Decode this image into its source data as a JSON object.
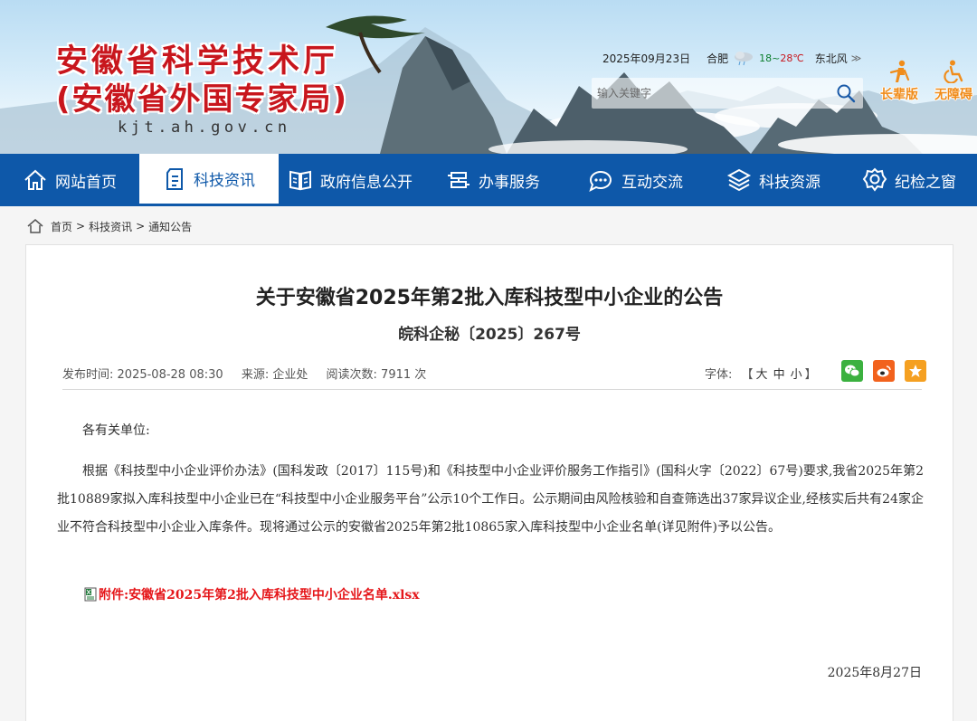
{
  "header": {
    "title": "安徽省科学技术厅",
    "subtitle": "(安徽省外国专家局)",
    "domain": "kjt.ah.gov.cn",
    "date": "2025年09月23日",
    "city": "合肥",
    "weather_icon": "rain-cloud-icon",
    "temp_low": "18",
    "temp_sep": "~",
    "temp_high": "28℃",
    "wind": "东北风",
    "more": "≫",
    "search_placeholder": "输入关键字",
    "tools": [
      {
        "label": "长辈版",
        "icon": "elder-icon"
      },
      {
        "label": "无障碍",
        "icon": "accessibility-icon"
      }
    ]
  },
  "nav": {
    "items": [
      {
        "label": "网站首页",
        "icon": "home-icon"
      },
      {
        "label": "科技资讯",
        "icon": "document-icon"
      },
      {
        "label": "政府信息公开",
        "icon": "book-icon"
      },
      {
        "label": "办事服务",
        "icon": "service-icon"
      },
      {
        "label": "互动交流",
        "icon": "chat-icon"
      },
      {
        "label": "科技资源",
        "icon": "cube-icon"
      },
      {
        "label": "纪检之窗",
        "icon": "badge-icon"
      }
    ],
    "active": "科技资讯"
  },
  "breadcrumb": {
    "items": [
      "首页",
      "科技资讯",
      "通知公告"
    ],
    "sep": ">"
  },
  "article": {
    "title": "关于安徽省2025年第2批入库科技型中小企业的公告",
    "doc_no": "皖科企秘〔2025〕267号",
    "publish_label": "发布时间:",
    "publish_time": "2025-08-28 08:30",
    "source_label": "来源:",
    "source": "企业处",
    "views_label": "阅读次数:",
    "views": "7911",
    "views_unit": "次",
    "font_label": "字体:",
    "font_open": "【",
    "font_sizes": [
      "大",
      "中",
      "小"
    ],
    "font_close": "】",
    "share": [
      {
        "name": "wechat",
        "color": "#3bb13f"
      },
      {
        "name": "weibo",
        "color": "#f2621d"
      },
      {
        "name": "favorite",
        "color": "#f5a021"
      }
    ],
    "greeting": "各有关单位:",
    "body": "根据《科技型中小企业评价办法》(国科发政〔2017〕115号)和《科技型中小企业评价服务工作指引》(国科火字〔2022〕67号)要求,我省2025年第2批10889家拟入库科技型中小企业已在“科技型中小企业服务平台”公示10个工作日。公示期间由风险核验和自查筛选出37家异议企业,经核实后共有24家企业不符合科技型中小企业入库条件。现将通过公示的安徽省2025年第2批10865家入库科技型中小企业名单(详见附件)予以公告。",
    "attachment": "附件:安徽省2025年第2批入库科技型中小企业名单.xlsx",
    "sign_date": "2025年8月27日"
  }
}
